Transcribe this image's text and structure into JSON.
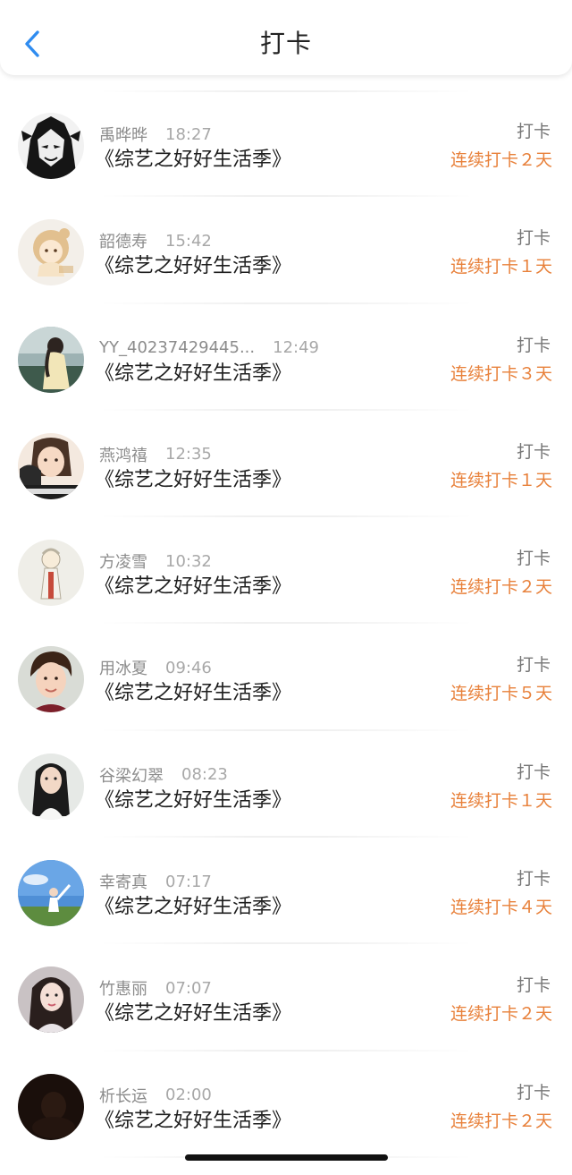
{
  "header": {
    "title": "打卡",
    "back_icon": "chevron-left-icon"
  },
  "colors": {
    "accent_blue": "#2f8cf0",
    "streak_orange": "#e8813b",
    "meta_gray": "#8c8c8c",
    "title_black": "#1e1e1e"
  },
  "checkins": [
    {
      "user": "禹晔晔",
      "time": "18:27",
      "book": "《综艺之好好生活季》",
      "action": "打卡",
      "streak": "连续打卡２天"
    },
    {
      "user": "韶德寿",
      "time": "15:42",
      "book": "《综艺之好好生活季》",
      "action": "打卡",
      "streak": "连续打卡１天"
    },
    {
      "user": "YY_40237429445...",
      "time": "12:49",
      "book": "《综艺之好好生活季》",
      "action": "打卡",
      "streak": "连续打卡３天"
    },
    {
      "user": "燕鸿禧",
      "time": "12:35",
      "book": "《综艺之好好生活季》",
      "action": "打卡",
      "streak": "连续打卡１天"
    },
    {
      "user": "方凌雪",
      "time": "10:32",
      "book": "《综艺之好好生活季》",
      "action": "打卡",
      "streak": "连续打卡２天"
    },
    {
      "user": "用冰夏",
      "time": "09:46",
      "book": "《综艺之好好生活季》",
      "action": "打卡",
      "streak": "连续打卡５天"
    },
    {
      "user": "谷梁幻翠",
      "time": "08:23",
      "book": "《综艺之好好生活季》",
      "action": "打卡",
      "streak": "连续打卡１天"
    },
    {
      "user": "幸寄真",
      "time": "07:17",
      "book": "《综艺之好好生活季》",
      "action": "打卡",
      "streak": "连续打卡４天"
    },
    {
      "user": "竹惠丽",
      "time": "07:07",
      "book": "《综艺之好好生活季》",
      "action": "打卡",
      "streak": "连续打卡２天"
    },
    {
      "user": "析长运",
      "time": "02:00",
      "book": "《综艺之好好生活季》",
      "action": "打卡",
      "streak": "连续打卡２天"
    }
  ]
}
